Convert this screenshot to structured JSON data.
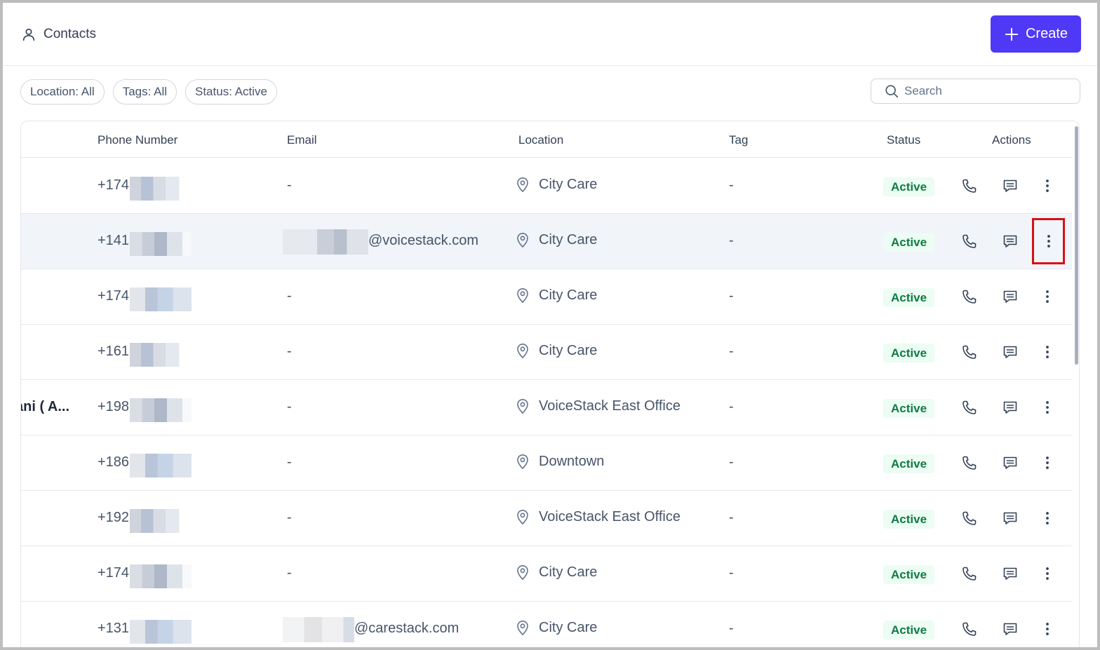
{
  "header": {
    "title": "Contacts",
    "title_icon": "user-icon",
    "create_label": "Create"
  },
  "filters": [
    {
      "label": "Location: All"
    },
    {
      "label": "Tags: All"
    },
    {
      "label": "Status: Active"
    }
  ],
  "search": {
    "placeholder": "Search",
    "value": ""
  },
  "table": {
    "columns": [
      "Phone Number",
      "Email",
      "Location",
      "Tag",
      "Status",
      "Actions"
    ],
    "rows": [
      {
        "name": "",
        "phone": "+174",
        "email_visible": "-",
        "location": "City Care",
        "tag": "-",
        "status": "Active",
        "highlighted": false
      },
      {
        "name": "",
        "phone": "+141",
        "email_visible": "@voicestack.com",
        "location": "City Care",
        "tag": "-",
        "status": "Active",
        "highlighted": true
      },
      {
        "name": "",
        "phone": "+174",
        "email_visible": "-",
        "location": "City Care",
        "tag": "-",
        "status": "Active",
        "highlighted": false
      },
      {
        "name": "",
        "phone": "+161",
        "email_visible": "-",
        "location": "City Care",
        "tag": "-",
        "status": "Active",
        "highlighted": false
      },
      {
        "name": "ani ( A...",
        "phone": "+198",
        "email_visible": "-",
        "location": "VoiceStack East Office",
        "tag": "-",
        "status": "Active",
        "highlighted": false
      },
      {
        "name": "",
        "phone": "+186",
        "email_visible": "-",
        "location": "Downtown",
        "tag": "-",
        "status": "Active",
        "highlighted": false
      },
      {
        "name": "",
        "phone": "+192",
        "email_visible": "-",
        "location": "VoiceStack East Office",
        "tag": "-",
        "status": "Active",
        "highlighted": false
      },
      {
        "name": "",
        "phone": "+174",
        "email_visible": "-",
        "location": "City Care",
        "tag": "-",
        "status": "Active",
        "highlighted": false
      },
      {
        "name": "",
        "phone": "+131",
        "email_visible": "@carestack.com",
        "location": "City Care",
        "tag": "-",
        "status": "Active",
        "highlighted": false
      }
    ],
    "row_actions": [
      "phone-icon",
      "message-icon",
      "more-vertical-icon"
    ]
  },
  "colors": {
    "primary": "#4f39f6",
    "status_active_text": "#0f7b43",
    "status_active_bg": "#ecfdf3",
    "highlight_box": "#d80f16",
    "row_hover": "#f1f4f8"
  }
}
